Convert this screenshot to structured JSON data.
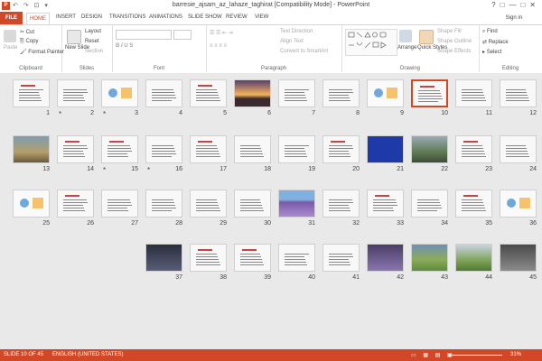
{
  "window": {
    "title": "barresie_ajsam_az_lahaze_taghirat [Compatibility Mode] - PowerPoint",
    "controls": [
      "?",
      "□",
      "—",
      "□",
      "✕"
    ]
  },
  "qat": "↶ ↷ ⊡ ▾",
  "tabs": {
    "file": "FILE",
    "home": "HOME",
    "insert": "INSERT",
    "design": "DESIGN",
    "transitions": "TRANSITIONS",
    "animations": "ANIMATIONS",
    "slideshow": "SLIDE SHOW",
    "review": "REVIEW",
    "view": "VIEW"
  },
  "signin": "Sign in",
  "ribbon": {
    "clipboard": {
      "paste": "Paste",
      "cut": "Cut",
      "copy": "Copy",
      "format_painter": "Format Painter",
      "label": "Clipboard"
    },
    "slides": {
      "new_slide": "New Slide",
      "layout": "Layout",
      "reset": "Reset",
      "section": "Section",
      "label": "Slides"
    },
    "font": {
      "label": "Font"
    },
    "paragraph": {
      "text_direction": "Text Direction",
      "align_text": "Align Text",
      "convert": "Convert to SmartArt",
      "label": "Paragraph"
    },
    "drawing": {
      "arrange": "Arrange",
      "quick_styles": "Quick Styles",
      "shape_fill": "Shape Fill",
      "shape_outline": "Shape Outline",
      "shape_effects": "Shape Effects",
      "label": "Drawing"
    },
    "editing": {
      "find": "Find",
      "replace": "Replace",
      "select": "Select",
      "label": "Editing"
    }
  },
  "slides": {
    "selected": "10",
    "rows": [
      [
        "12",
        "11",
        "10",
        "9",
        "8",
        "7",
        "6",
        "5",
        "4",
        "3",
        "2",
        "1"
      ],
      [
        "24",
        "23",
        "22",
        "21",
        "20",
        "19",
        "18",
        "17",
        "16",
        "15",
        "14",
        "13"
      ],
      [
        "36",
        "35",
        "34",
        "33",
        "32",
        "31",
        "30",
        "29",
        "28",
        "27",
        "26",
        "25"
      ],
      [
        "45",
        "44",
        "43",
        "42",
        "41",
        "40",
        "39",
        "38",
        "37"
      ]
    ],
    "starred": [
      "3",
      "2",
      "16",
      "15"
    ],
    "star_symbol": "*"
  },
  "status": {
    "slide": "SLIDE 10 OF 45",
    "language": "ENGLISH (UNITED STATES)",
    "zoom": "31%"
  },
  "colors": {
    "accent": "#d24726"
  }
}
